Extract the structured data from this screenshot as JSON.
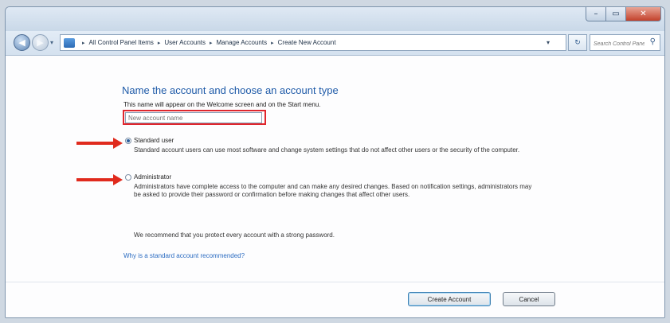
{
  "window": {
    "min_glyph": "–",
    "max_glyph": "▭",
    "close_glyph": "✕"
  },
  "nav": {
    "back_glyph": "◀",
    "forward_glyph": "▶",
    "recent_glyph": "▾",
    "breadcrumbs": [
      "All Control Panel Items",
      "User Accounts",
      "Manage Accounts",
      "Create New Account"
    ],
    "separator": "▸",
    "dropdown_glyph": "▾",
    "refresh_glyph": "↻",
    "search_placeholder": "Search Control Panel",
    "search_glyph": "⚲"
  },
  "content": {
    "heading": "Name the account and choose an account type",
    "description": "This name will appear on the Welcome screen and on the Start menu.",
    "name_placeholder": "New account name",
    "standard_label": "Standard user",
    "standard_desc": "Standard account users can use most software and change system settings that do not affect other users or the security of the computer.",
    "admin_label": "Administrator",
    "admin_desc": "Administrators have complete access to the computer and can make any desired changes. Based on notification settings, administrators may be asked to provide their password or confirmation before making changes that affect other users.",
    "recommend": "We recommend that you protect every account with a strong password.",
    "help_link": "Why is a standard account recommended?"
  },
  "buttons": {
    "create": "Create Account",
    "cancel": "Cancel"
  },
  "selected_account_type": "Standard user",
  "colors": {
    "accent_link": "#2a6bc1",
    "heading": "#1e5aa8",
    "annotation": "#e0262d"
  }
}
